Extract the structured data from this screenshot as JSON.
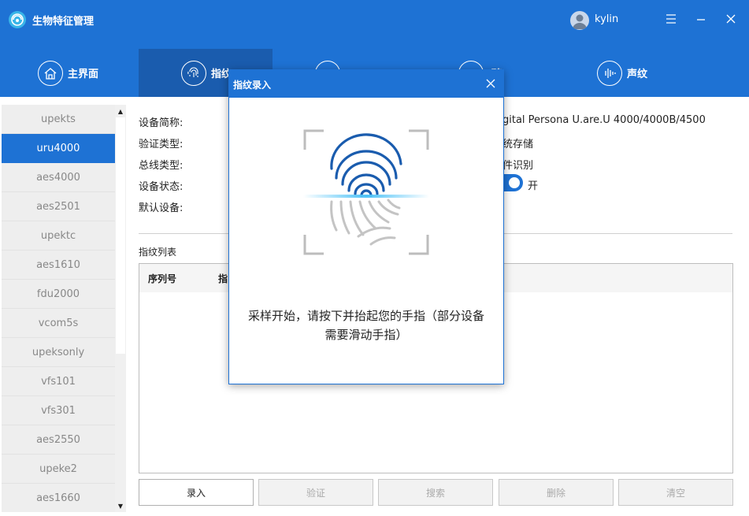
{
  "app": {
    "title": "生物特征管理",
    "user": "kylin",
    "accent": "#1e72d4"
  },
  "nav": {
    "tabs": [
      {
        "label": "主界面",
        "icon": "home-icon"
      },
      {
        "label": "指纹",
        "icon": "fingerprint-icon"
      },
      {
        "label": "",
        "icon": "finger-vein-icon"
      },
      {
        "label": "",
        "icon": "iris-icon"
      },
      {
        "label": "声纹",
        "icon": "voiceprint-icon"
      }
    ],
    "fingerprint_label": "指纹",
    "fp_partial_end": "琏"
  },
  "sidebar": {
    "items": [
      "upekts",
      "uru4000",
      "aes4000",
      "aes2501",
      "upektc",
      "aes1610",
      "fdu2000",
      "vcom5s",
      "upeksonly",
      "vfs101",
      "vfs301",
      "aes2550",
      "upeke2",
      "aes1660"
    ],
    "selected": "uru4000"
  },
  "device": {
    "labels": {
      "name": "设备简称:",
      "verify_type": "验证类型:",
      "bus_type": "总线类型:",
      "status": "设备状态:",
      "default": "默认设备:"
    },
    "values": {
      "name_partial": "gital Persona U.are.U 4000/4000B/4500",
      "verify_partial": "统存储",
      "bus_partial": "件识别",
      "status_toggle": "开"
    }
  },
  "fingerprint_list": {
    "title": "指纹列表",
    "columns": [
      "序列号",
      "指"
    ]
  },
  "buttons": {
    "enroll": "录入",
    "verify": "验证",
    "search": "搜索",
    "delete": "删除",
    "clear": "清空"
  },
  "dialog": {
    "title": "指纹录入",
    "message_line1": "采样开始，请按下并抬起您的手指（部分设备",
    "message_line2": "需要滑动手指）"
  }
}
